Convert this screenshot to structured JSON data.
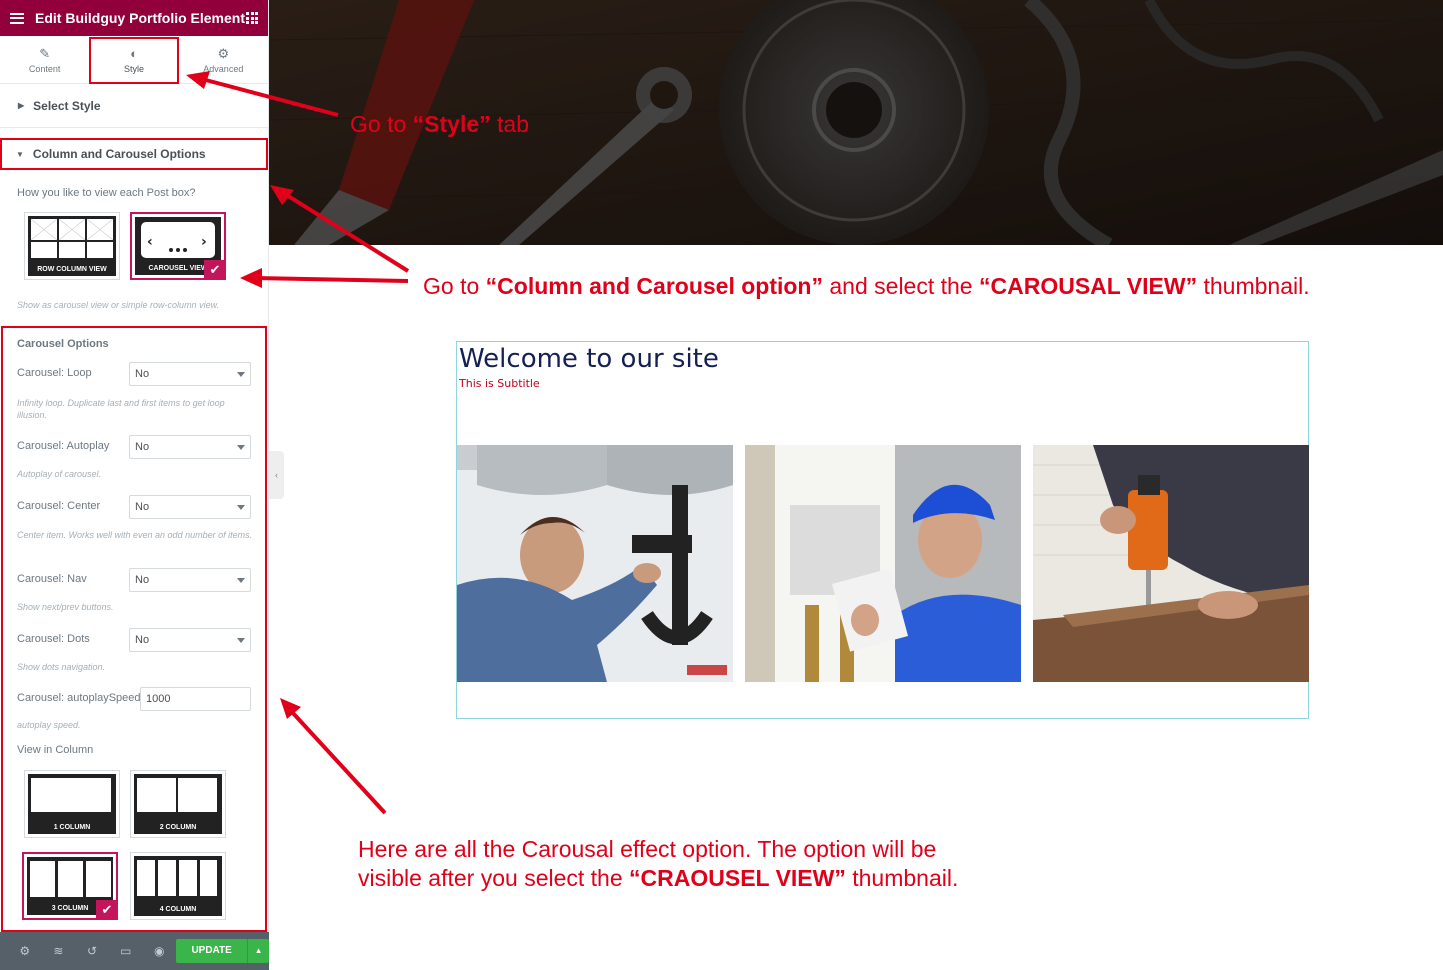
{
  "editor": {
    "title": "Edit Buildguy Portfolio Element",
    "tabs": [
      {
        "label": "Content",
        "icon": "pencil-icon"
      },
      {
        "label": "Style",
        "icon": "contrast-icon"
      },
      {
        "label": "Advanced",
        "icon": "gear-icon"
      }
    ],
    "sections": {
      "select_style": "Select Style",
      "column_carousel": "Column and Carousel Options"
    },
    "view_question": "How you like to view each Post box?",
    "view_thumbs": [
      {
        "label": "ROW COLUMN VIEW",
        "selected": false
      },
      {
        "label": "CAROUSEL VIEW",
        "selected": true
      }
    ],
    "view_help": "Show as carousel view or simple row-column view.",
    "carousel_heading": "Carousel Options",
    "options": [
      {
        "label": "Carousel: Loop",
        "value": "No",
        "help": "Infinity loop. Duplicate last and first items to get loop illusion."
      },
      {
        "label": "Carousel: Autoplay",
        "value": "No",
        "help": "Autoplay of carousel."
      },
      {
        "label": "Carousel: Center",
        "value": "No",
        "help": "Center item. Works well with even an odd number of items."
      },
      {
        "label": "Carousel: Nav",
        "value": "No",
        "help": "Show next/prev buttons."
      },
      {
        "label": "Carousel: Dots",
        "value": "No",
        "help": "Show dots navigation."
      }
    ],
    "autoplay_speed": {
      "label": "Carousel: autoplaySpeed",
      "value": "1000",
      "help": "autoplay speed."
    },
    "column_label": "View in Column",
    "column_thumbs": [
      {
        "label": "1 COLUMN",
        "selected": false
      },
      {
        "label": "2 COLUMN",
        "selected": false
      },
      {
        "label": "3 COLUMN",
        "selected": true
      },
      {
        "label": "4 COLUMN",
        "selected": false
      }
    ],
    "footer": {
      "update_label": "UPDATE"
    }
  },
  "preview": {
    "title": "Welcome to our site",
    "subtitle": "This is Subtitle"
  },
  "annotations": {
    "style_tab": {
      "pre": "Go  to ",
      "bold": "“Style”",
      "post": " tab"
    },
    "column_option": {
      "pre": "Go to ",
      "bold1": "“Column and Carousel option”",
      "mid": " and select the ",
      "bold2": "“CAROUSAL VIEW”",
      "post": " thumbnail."
    },
    "carousel_effect": {
      "line1": "Here are all the Carousal effect option. The option will be",
      "line2_pre": "visible after you select the ",
      "line2_bold": "“CRAOUSEL VIEW”",
      "line2_post": " thumbnail."
    }
  },
  "colors": {
    "brand": "#92003b",
    "accent": "#c4145c",
    "annotation": "#e0001a",
    "update": "#39b54a"
  }
}
